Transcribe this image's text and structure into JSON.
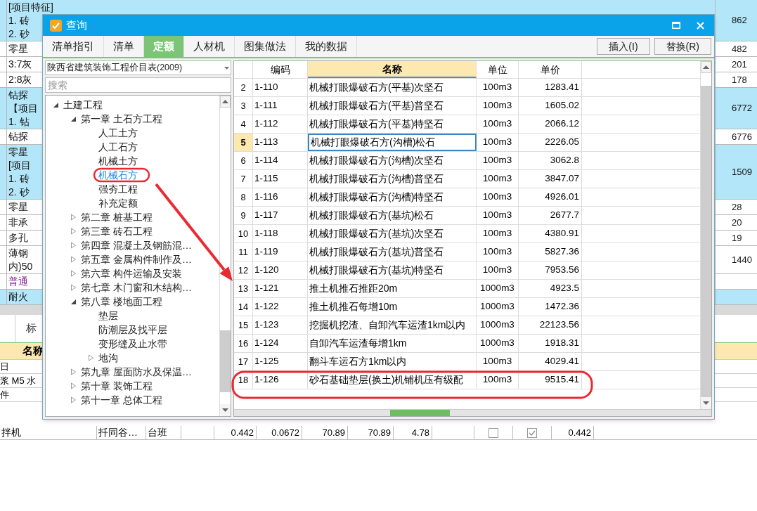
{
  "background_sheet": {
    "rows": [
      {
        "kind": "group",
        "lines": [
          "[项目特征]",
          "1. 砖",
          "2. 砂"
        ],
        "amount": "862"
      },
      {
        "kind": "item",
        "lines": [
          "零星"
        ],
        "amount": "482"
      },
      {
        "kind": "item",
        "lines": [
          "3:7灰"
        ],
        "amount": "201"
      },
      {
        "kind": "item",
        "lines": [
          "2:8灰"
        ],
        "amount": "178"
      },
      {
        "kind": "group",
        "lines": [
          "钻探",
          "【项目",
          "1. 钻"
        ],
        "amount": "6772"
      },
      {
        "kind": "item",
        "lines": [
          "钻探"
        ],
        "amount": "6776"
      },
      {
        "kind": "group",
        "lines": [
          "零星",
          "[项目",
          "1. 砖",
          "2. 砂"
        ],
        "amount": "1509"
      },
      {
        "kind": "item",
        "lines": [
          "零星"
        ],
        "amount": "28"
      },
      {
        "kind": "item",
        "lines": [
          "非承"
        ],
        "amount": "20"
      },
      {
        "kind": "item",
        "lines": [
          "多孔"
        ],
        "amount": "19"
      },
      {
        "kind": "item",
        "lines": [
          "薄钢",
          "内)50"
        ],
        "amount": "1440"
      },
      {
        "kind": "material",
        "lines": [
          "普通"
        ]
      },
      {
        "kind": "group",
        "lines": [
          "耐火"
        ]
      }
    ]
  },
  "lower_panel": {
    "tab": "标",
    "header": "名称",
    "rows": [
      "日",
      "浆 M5 水",
      "件"
    ],
    "bottom_row": [
      {
        "kind": "text",
        "text": "拌机"
      },
      {
        "kind": "text",
        "text": "扦同谷…"
      },
      {
        "kind": "text",
        "text": "台班"
      },
      {
        "kind": "blank"
      },
      {
        "kind": "number",
        "text": "0.442"
      },
      {
        "kind": "number",
        "text": "0.0672"
      },
      {
        "kind": "number",
        "text": "70.89"
      },
      {
        "kind": "number",
        "text": "70.89"
      },
      {
        "kind": "number",
        "text": "4.78"
      },
      {
        "kind": "blank"
      },
      {
        "kind": "check",
        "checked": false
      },
      {
        "kind": "check",
        "checked": true
      },
      {
        "kind": "number",
        "text": "0.442"
      }
    ]
  },
  "dialog": {
    "title": "查询",
    "tabs": [
      {
        "label": "清单指引",
        "selected": false
      },
      {
        "label": "清单",
        "selected": false
      },
      {
        "label": "定额",
        "selected": true
      },
      {
        "label": "人材机",
        "selected": false
      },
      {
        "label": "图集做法",
        "selected": false
      },
      {
        "label": "我的数据",
        "selected": false
      }
    ],
    "actions": [
      "插入(I)",
      "替换(R)"
    ],
    "library": {
      "value": "陕西省建筑装饰工程价目表(2009)"
    },
    "search": {
      "placeholder": "搜索"
    },
    "tree": [
      {
        "label": "土建工程",
        "expanded": true,
        "selected": false,
        "children": [
          {
            "label": "第一章 土石方工程",
            "expanded": true,
            "selected": false,
            "children": [
              {
                "label": "人工土方",
                "selected": false
              },
              {
                "label": "人工石方",
                "selected": false
              },
              {
                "label": "机械土方",
                "selected": false
              },
              {
                "label": "机械石方",
                "selected": true
              },
              {
                "label": "强夯工程",
                "selected": false
              },
              {
                "label": "补充定额",
                "selected": false
              }
            ]
          },
          {
            "label": "第二章 桩基工程",
            "expanded": false,
            "selected": false
          },
          {
            "label": "第三章 砖石工程",
            "expanded": false,
            "selected": false
          },
          {
            "label": "第四章 混凝土及钢筋混…",
            "expanded": false,
            "selected": false
          },
          {
            "label": "第五章 金属构件制作及…",
            "expanded": false,
            "selected": false
          },
          {
            "label": "第六章 构件运输及安装",
            "expanded": false,
            "selected": false
          },
          {
            "label": "第七章 木门窗和木结构…",
            "expanded": false,
            "selected": false
          },
          {
            "label": "第八章 楼地面工程",
            "expanded": true,
            "selected": false,
            "children": [
              {
                "label": "垫层",
                "selected": false
              },
              {
                "label": "防潮层及找平层",
                "selected": false
              },
              {
                "label": "变形缝及止水带",
                "selected": false
              },
              {
                "label": "地沟",
                "expanded": false,
                "selected": false
              }
            ]
          },
          {
            "label": "第九章 屋面防水及保温…",
            "expanded": false,
            "selected": false
          },
          {
            "label": "第十章 装饰工程",
            "expanded": false,
            "selected": false
          },
          {
            "label": "第十一章 总体工程",
            "expanded": false,
            "selected": false
          }
        ]
      }
    ],
    "table": {
      "columns": [
        {
          "label": "编码",
          "highlighted": false
        },
        {
          "label": "名称",
          "highlighted": true
        },
        {
          "label": "单位",
          "highlighted": false
        },
        {
          "label": "单价",
          "highlighted": false
        }
      ],
      "rows": [
        {
          "index": "2",
          "code": "1-110",
          "name": "机械打眼爆破石方(平基)次坚石",
          "unit": "100m3",
          "price": "1283.41",
          "selected": false
        },
        {
          "index": "3",
          "code": "1-111",
          "name": "机械打眼爆破石方(平基)普坚石",
          "unit": "100m3",
          "price": "1605.02",
          "selected": false
        },
        {
          "index": "4",
          "code": "1-112",
          "name": "机械打眼爆破石方(平基)特坚石",
          "unit": "100m3",
          "price": "2066.12",
          "selected": false
        },
        {
          "index": "5",
          "code": "1-113",
          "name": "机械打眼爆破石方(沟槽)松石",
          "unit": "100m3",
          "price": "2226.05",
          "selected": true
        },
        {
          "index": "6",
          "code": "1-114",
          "name": "机械打眼爆破石方(沟槽)次坚石",
          "unit": "100m3",
          "price": "3062.8",
          "selected": false
        },
        {
          "index": "7",
          "code": "1-115",
          "name": "机械打眼爆破石方(沟槽)普坚石",
          "unit": "100m3",
          "price": "3847.07",
          "selected": false
        },
        {
          "index": "8",
          "code": "1-116",
          "name": "机械打眼爆破石方(沟槽)特坚石",
          "unit": "100m3",
          "price": "4926.01",
          "selected": false
        },
        {
          "index": "9",
          "code": "1-117",
          "name": "机械打眼爆破石方(基坑)松石",
          "unit": "100m3",
          "price": "2677.7",
          "selected": false
        },
        {
          "index": "10",
          "code": "1-118",
          "name": "机械打眼爆破石方(基坑)次坚石",
          "unit": "100m3",
          "price": "4380.91",
          "selected": false
        },
        {
          "index": "11",
          "code": "1-119",
          "name": "机械打眼爆破石方(基坑)普坚石",
          "unit": "100m3",
          "price": "5827.36",
          "selected": false
        },
        {
          "index": "12",
          "code": "1-120",
          "name": "机械打眼爆破石方(基坑)特坚石",
          "unit": "100m3",
          "price": "7953.56",
          "selected": false
        },
        {
          "index": "13",
          "code": "1-121",
          "name": "推土机推石推距20m",
          "unit": "1000m3",
          "price": "4923.5",
          "selected": false
        },
        {
          "index": "14",
          "code": "1-122",
          "name": "推土机推石每增10m",
          "unit": "1000m3",
          "price": "1472.36",
          "selected": false
        },
        {
          "index": "15",
          "code": "1-123",
          "name": "挖掘机挖渣、自卸汽车运渣1km以内",
          "unit": "1000m3",
          "price": "22123.56",
          "selected": false
        },
        {
          "index": "16",
          "code": "1-124",
          "name": "自卸汽车运渣每增1km",
          "unit": "1000m3",
          "price": "1918.31",
          "selected": false
        },
        {
          "index": "17",
          "code": "1-125",
          "name": "翻斗车运石方1km以内",
          "unit": "100m3",
          "price": "4029.41",
          "selected": false
        },
        {
          "index": "18",
          "code": "1-126",
          "name": "砂石基础垫层(换土)机铺机压有级配",
          "unit": "100m3",
          "price": "9515.41",
          "selected": false
        }
      ]
    }
  }
}
